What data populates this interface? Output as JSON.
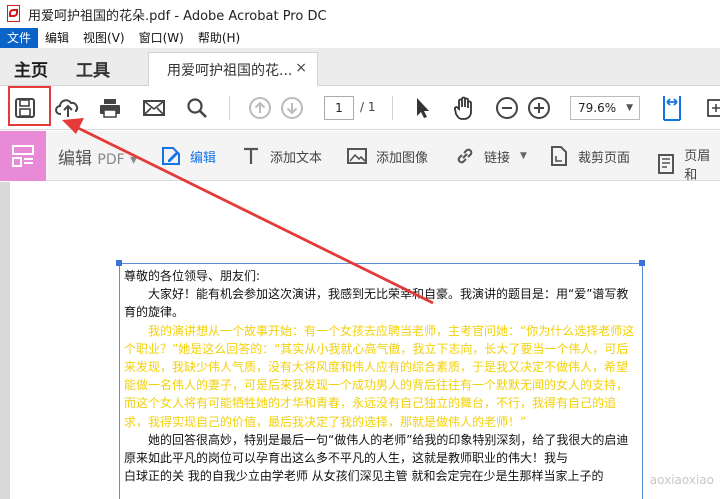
{
  "window": {
    "title": "用爱呵护祖国的花朵.pdf - Adobe Acrobat Pro DC"
  },
  "menu": {
    "items": [
      "文件",
      "编辑",
      "视图(V)",
      "窗口(W)",
      "帮助(H)"
    ]
  },
  "tabs": {
    "home": "主页",
    "tools": "工具",
    "document": "用爱呵护祖国的花...",
    "close": "×"
  },
  "toolbar": {
    "page_current": "1",
    "page_total": "/ 1",
    "zoom": "79.6%",
    "zoom_arrow": "▼",
    "icons": [
      "save-icon",
      "upload-icon",
      "print-icon",
      "email-icon",
      "search-icon",
      "prev-page-icon",
      "next-page-icon",
      "select-icon",
      "hand-icon",
      "zoom-out-icon",
      "zoom-in-icon",
      "fit-width-icon"
    ]
  },
  "edit_toolbar": {
    "title": "编辑",
    "title_suffix": "PDF",
    "items": {
      "edit": "编辑",
      "add_text": "添加文本",
      "add_image": "添加图像",
      "link": "链接",
      "crop": "裁剪页面",
      "header": "页眉和"
    }
  },
  "document": {
    "salutation": "尊敬的各位领导、朋友们:",
    "para1": "大家好！能有机会参加这次演讲，我感到无比荣幸和自豪。我演讲的题目是：用“爱”谱写教育的旋律。",
    "para2": "我的演讲想从一个故事开始：有一个女孩去应聘当老师，主考官问她：“你为什么选择老师这个职业？”她是这么回答的：“其实从小我就心高气傲，我立下志向，长大了要当一个伟人，可后来发现，我缺少伟人气质，没有大将风度和伟人应有的综合素质，于是我又决定不做伟人，希望能做一名伟人的妻子，可是后来我发现一个成功男人的背后往往有一个默默无闻的女人的支持，而这个女人将有可能牺牲她的才华和青春，永远没有自己独立的舞台，不行，我得有自己的追求，我得实现自己的价值，最后我决定了我的选择，那就是做伟人的老师！”",
    "para3": "她的回答很高妙，特别是最后一句“做伟人的老师”给我的印象特别深刻，给了我很大的启迪 原来如此平凡的岗位可以孕育出这么多不平凡的人生，这就是教师职业的伟大！我与",
    "para3b": "白球正的关 我的自我少立由学老师 从女孩们深见主管 就和会定完在少是生那样当家上子的",
    "watermark": "aoxiaoxiao"
  },
  "colors": {
    "accent": "#1473e6",
    "highlight_box": "#e43a3a",
    "edit_side": "#e88ad6",
    "yellow_text": "#f2d10a",
    "menu_active": "#0a64c8"
  }
}
